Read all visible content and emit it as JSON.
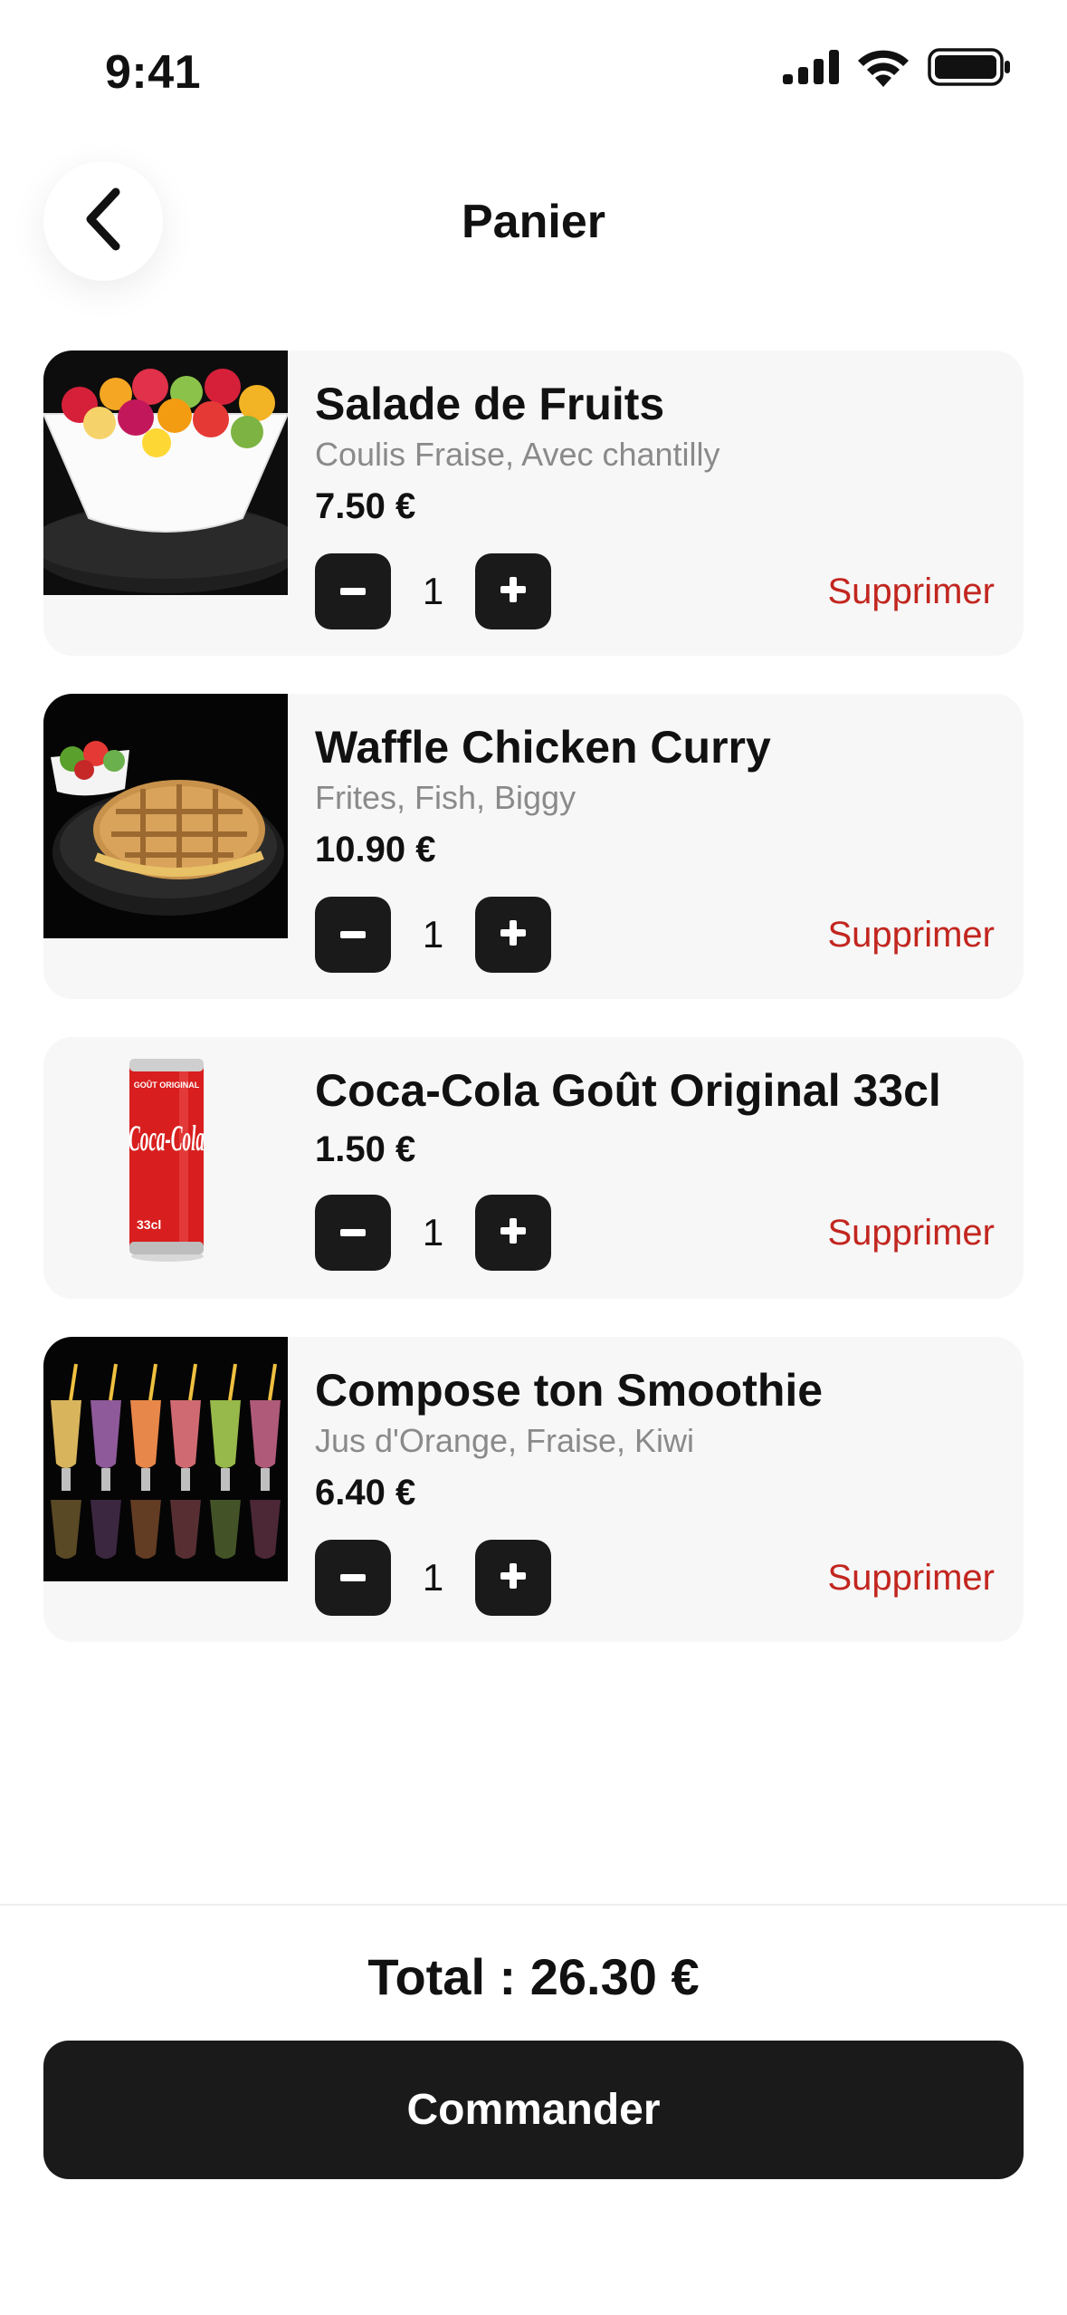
{
  "status_bar": {
    "time": "9:41",
    "icons": [
      "cellular-signal-icon",
      "wifi-icon",
      "battery-icon"
    ]
  },
  "header": {
    "back_icon": "chevron-left-icon",
    "title": "Panier"
  },
  "cart": {
    "items": [
      {
        "name": "Salade de Fruits",
        "options": "Coulis Fraise, Avec chantilly",
        "price": "7.50 €",
        "quantity": "1",
        "delete_label": "Supprimer",
        "image": "fruit-salad-bowl-image"
      },
      {
        "name": "Waffle Chicken Curry",
        "options": "Frites, Fish, Biggy",
        "price": "10.90 €",
        "quantity": "1",
        "delete_label": "Supprimer",
        "image": "waffle-sandwich-image"
      },
      {
        "name": "Coca-Cola Goût Original 33cl",
        "options": "",
        "price": "1.50 €",
        "quantity": "1",
        "delete_label": "Supprimer",
        "image": "coca-cola-can-image",
        "image_text": [
          "GOÛT ORIGINAL",
          "Coca-Cola",
          "33cl"
        ]
      },
      {
        "name": "Compose ton Smoothie",
        "options": "Jus d'Orange, Fraise, Kiwi",
        "price": "6.40 €",
        "quantity": "1",
        "delete_label": "Supprimer",
        "image": "smoothies-row-image"
      }
    ],
    "minus_icon": "minus-icon",
    "plus_icon": "plus-icon"
  },
  "footer": {
    "total": "Total : 26.30 €",
    "order_button": "Commander"
  },
  "colors": {
    "primary_dark": "#1a1a1a",
    "card_bg": "#f7f7f7",
    "delete_red": "#c2261f",
    "muted_text": "#8a8a8a"
  }
}
